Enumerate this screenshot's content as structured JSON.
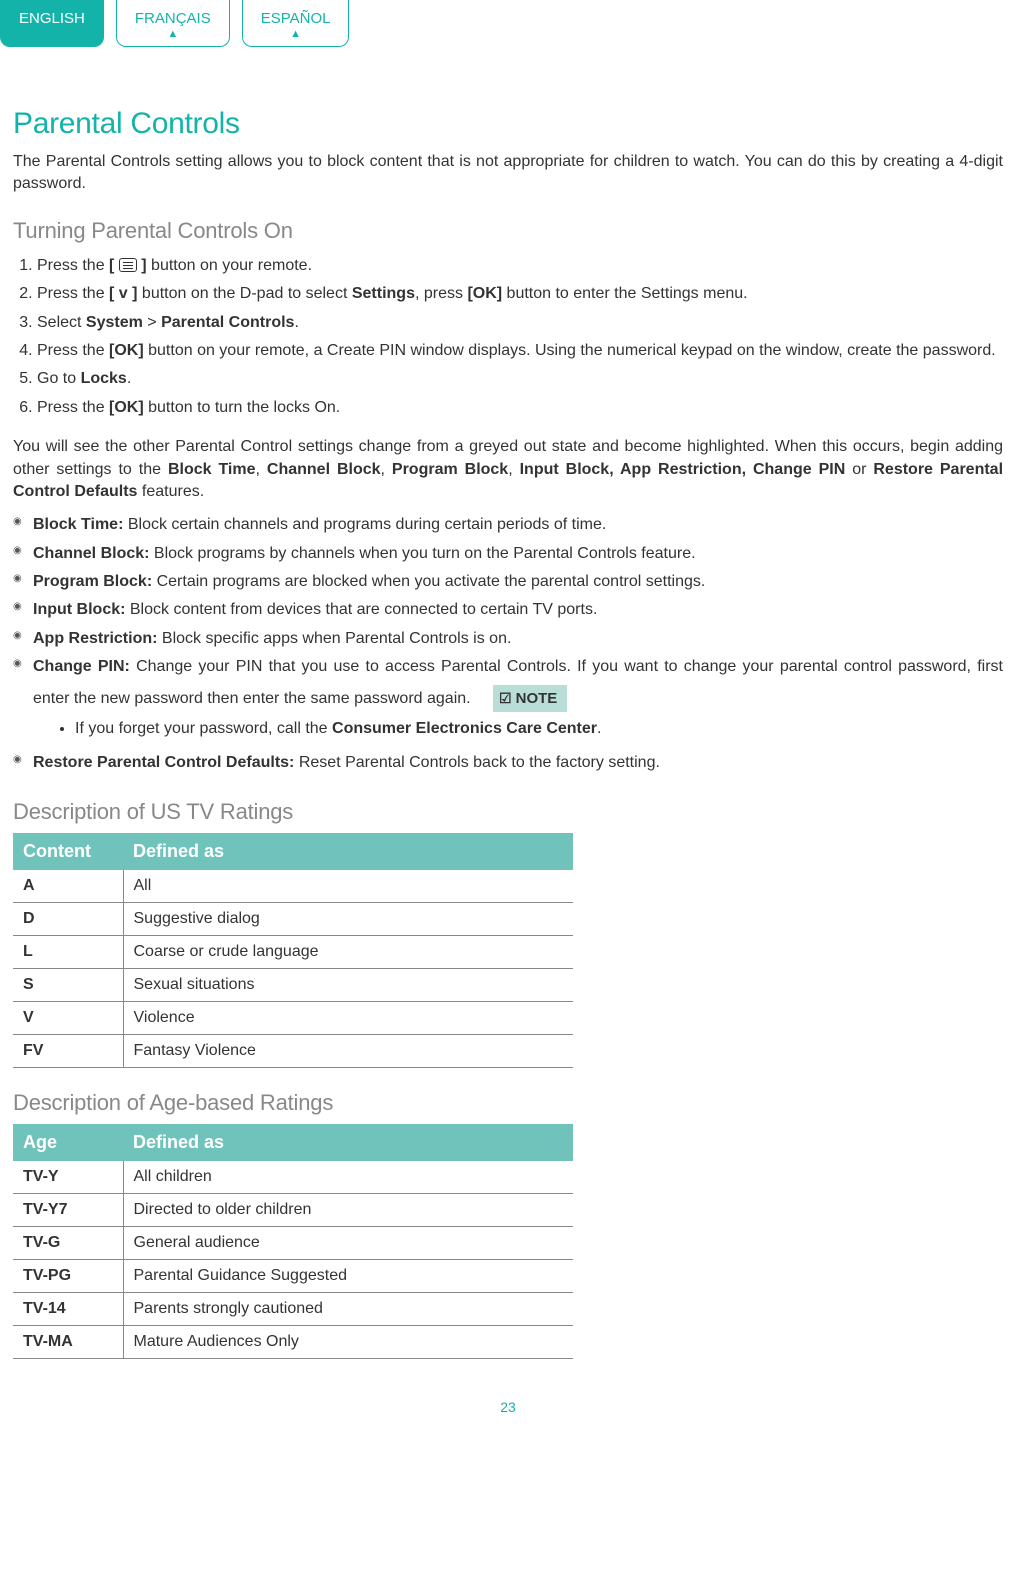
{
  "tabs": {
    "english": "ENGLISH",
    "francais": "FRANÇAIS",
    "espanol": "ESPAÑOL"
  },
  "h1": "Parental Controls",
  "intro": "The Parental Controls setting allows you to block content that is not appropriate for children to watch. You can do this by creating a 4-digit password.",
  "h2_turningon": "Turning Parental Controls On",
  "step1_a": "Press the ",
  "step1_b": " button on your remote.",
  "step2_a": "Press the ",
  "step2_b": "[ v ]",
  "step2_c": " button on the D-pad to select ",
  "step2_d": "Settings",
  "step2_e": ", press ",
  "step2_f": "[OK]",
  "step2_g": " button to enter the Settings menu.",
  "step3_a": "Select ",
  "step3_b": "System",
  "step3_c": " > ",
  "step3_d": "Parental Controls",
  "step3_e": ".",
  "step4_a": "Press the ",
  "step4_b": "[OK]",
  "step4_c": " button on your remote, a Create PIN window displays. Using the numerical keypad on the window, create the password.",
  "step5_a": "Go to ",
  "step5_b": "Locks",
  "step5_c": ".",
  "step6_a": "Press the ",
  "step6_b": "[OK]",
  "step6_c": " button to turn the locks On.",
  "after_a": "You will see the other Parental Control settings change from a greyed out state and become highlighted. When this occurs, begin adding other settings to the ",
  "after_b": "Block Time",
  "after_c": ", ",
  "after_d": "Channel Block",
  "after_e": ", ",
  "after_f": "Program Block",
  "after_g": ", ",
  "after_h": "Input Block, App Restriction, Change PIN",
  "after_i": " or ",
  "after_j": "Restore Parental Control Defaults",
  "after_k": " features.",
  "feat_bt_t": "Block Time:",
  "feat_bt_d": " Block certain channels and programs during certain periods of time.",
  "feat_cb_t": "Channel Block:",
  "feat_cb_d": " Block programs by channels when you turn on the Parental Controls feature.",
  "feat_pb_t": "Program Block:",
  "feat_pb_d": " Certain programs are blocked when you activate the parental control settings.",
  "feat_ib_t": "Input Block:",
  "feat_ib_d": " Block content from devices that are connected to certain TV ports.",
  "feat_ar_t": "App Restriction:",
  "feat_ar_d": " Block specific apps when Parental Controls is on.",
  "feat_cp_t": "Change PIN:",
  "feat_cp_d": " Change your PIN that you use to access Parental Controls. If you want to change your parental control password, first enter the new password then enter the same password again.",
  "note_label": "NOTE",
  "note_a": "If you forget your password, call the ",
  "note_b": "Consumer Electronics Care Center",
  "note_c": ".",
  "feat_rd_t": "Restore Parental Control Defaults:",
  "feat_rd_d": " Reset Parental Controls back to the factory setting.",
  "h2_ustv": "Description of US TV Ratings",
  "th_content": "Content",
  "th_defined": "Defined as",
  "us_rows": [
    {
      "c": "A",
      "d": "All"
    },
    {
      "c": "D",
      "d": "Suggestive dialog"
    },
    {
      "c": "L",
      "d": "Coarse or crude language"
    },
    {
      "c": "S",
      "d": "Sexual situations"
    },
    {
      "c": "V",
      "d": "Violence"
    },
    {
      "c": "FV",
      "d": "Fantasy Violence"
    }
  ],
  "h2_age": "Description of Age-based Ratings",
  "th_age": "Age",
  "age_rows": [
    {
      "c": "TV-Y",
      "d": "All children"
    },
    {
      "c": "TV-Y7",
      "d": "Directed to older children"
    },
    {
      "c": "TV-G",
      "d": "General audience"
    },
    {
      "c": "TV-PG",
      "d": "Parental Guidance Suggested"
    },
    {
      "c": "TV-14",
      "d": "Parents strongly cautioned"
    },
    {
      "c": "TV-MA",
      "d": "Mature Audiences Only"
    }
  ],
  "pagenum": "23"
}
